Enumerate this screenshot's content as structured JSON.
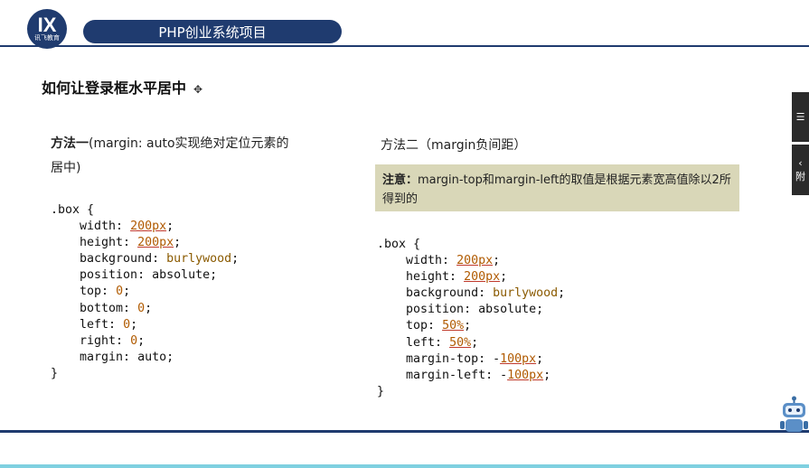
{
  "header": {
    "logo_mark": "IX",
    "logo_text": "讯飞教育",
    "title": "PHP创业系统项目"
  },
  "slide": {
    "heading": "如何让登录框水平居中",
    "method1": {
      "title_bold": "方法一",
      "title_rest": "(margin: auto实现绝对定位元素的居中)"
    },
    "method2": {
      "title": "方法二（margin负间距）",
      "note_label": "注意：",
      "note_text": "margin-top和margin-left的取值是根据元素宽高值除以2所得到的"
    }
  },
  "code1": [
    ".box {",
    "    width: 200px;",
    "    height: 200px;",
    "    background: burlywood;",
    "    position: absolute;",
    "    top: 0;",
    "    bottom: 0;",
    "    left: 0;",
    "    right: 0;",
    "    margin: auto;",
    "}"
  ],
  "code2": [
    ".box {",
    "    width: 200px;",
    "    height: 200px;",
    "    background: burlywood;",
    "    position: absolute;",
    "    top: 50%;",
    "    left: 50%;",
    "    margin-top: -100px;",
    "    margin-left: -100px;",
    "}"
  ],
  "side_tabs": {
    "tab1_icon": "☰",
    "tab2_icon": "‹",
    "tab2_text": "附"
  },
  "colors": {
    "brand_navy": "#1f3b6f",
    "note_bg": "#d9d7b8",
    "bottom_strip": "#7fd0e0"
  }
}
